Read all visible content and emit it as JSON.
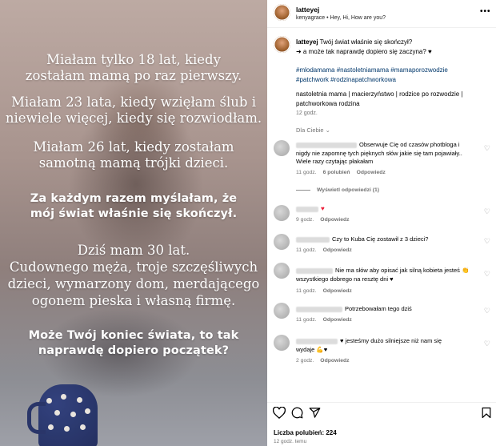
{
  "header": {
    "username": "latteyej",
    "subline": "kenyagrace • Hey, Hi, How are you?",
    "more_icon": "more-horizontal-icon"
  },
  "overlay": {
    "l1": "Miałam tylko 18 lat, kiedy",
    "l2": "zostałam mamą po raz pierwszy.",
    "l3": "Miałam 23 lata, kiedy wzięłam ślub i",
    "l4": "niewiele więcej, kiedy się rozwiodłam.",
    "l5": "Miałam 26 lat, kiedy zostałam",
    "l6": "samotną mamą trójki dzieci.",
    "l7": "Za każdym razem myślałam, że",
    "l8": "mój świat właśnie się skończył.",
    "l9": "Dziś mam 30 lat.",
    "l10": "Cudownego męża, troje szczęśliwych",
    "l11": "dzieci, wymarzony dom, merdającego",
    "l12": "ogonem pieska i własną firmę.",
    "l13": "Może Twój koniec świata, to tak",
    "l14": "naprawdę dopiero początek?"
  },
  "caption": {
    "username": "latteyej",
    "line1": "Twój świat właśnie się skończył?",
    "line2": "➜ a może tak naprawdę dopiero się zaczyna? ♥",
    "tags1": "#mlodamama #nastoletniamama #mamaporozwodzie",
    "tags2": "#patchwork #rodzinapatchworkowa",
    "body1": "nastoletnia mama | macierzyństwo | rodzice po rozwodzie |",
    "body2": "patchworkowa rodzina",
    "time": "12 godz."
  },
  "sort_label": "Dla Ciebie ⌄",
  "comments": [
    {
      "line1": "Obserwuje Cię od czasów photbloga i",
      "line2": "nigdy nie zapomnę tych pięknych słów jakie się tam pojawiały..",
      "line3": "Wiele razy czytając płakałam",
      "time": "11 godz.",
      "likes": "6 polubień",
      "reply": "Odpowiedz",
      "replies": "Wyświetl odpowiedzi (1)"
    },
    {
      "line1": "♥",
      "time": "9 godz.",
      "reply": "Odpowiedz"
    },
    {
      "line1": "Czy to Kuba Cię zostawił z 3 dzieci?",
      "time": "11 godz.",
      "reply": "Odpowiedz"
    },
    {
      "line1": "Nie ma słów aby opisać jak silną kobieta jesteś 👏",
      "line2": "wszystkiego dobrego na resztę dni ♥",
      "time": "11 godz.",
      "reply": "Odpowiedz"
    },
    {
      "line1": "Potrzebowałam tego dziś",
      "time": "11 godz.",
      "reply": "Odpowiedz"
    },
    {
      "line1": "♥ jesteśmy dużo silniejsze niż nam się",
      "line2": "wydaje 💪♥",
      "time": "2 godz.",
      "reply": "Odpowiedz"
    }
  ],
  "actions": {
    "like_icon": "heart-icon",
    "comment_icon": "comment-icon",
    "share_icon": "send-icon",
    "save_icon": "bookmark-icon"
  },
  "likes_text": "Liczba polubień: 224",
  "time_ago": "12 godz. temu",
  "colors": {
    "hashtag": "#00376b",
    "heart": "#ed1f3a",
    "muted": "#737373"
  }
}
